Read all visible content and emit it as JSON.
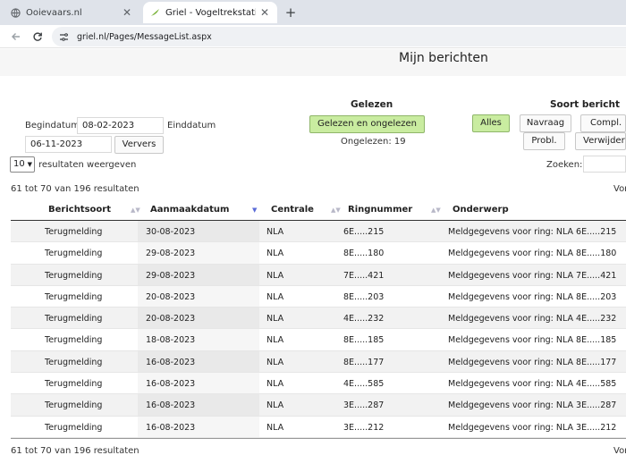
{
  "browser": {
    "tabs": [
      {
        "title": "Ooievaars.nl",
        "active": false
      },
      {
        "title": "Griel - Vogeltrekstation Neder",
        "active": true
      }
    ],
    "new_tab_label": "+",
    "url": "griel.nl/Pages/MessageList.aspx"
  },
  "page": {
    "title": "Mijn berichten"
  },
  "filters": {
    "begindatum_label": "Begindatum",
    "begindatum_value": "08-02-2023",
    "einddatum_label": "Einddatum",
    "einddatum_value": "06-11-2023",
    "ververs_label": "Ververs",
    "gelezen_heading": "Gelezen",
    "gelezen_button": "Gelezen en ongelezen",
    "ongelezen_text": "Ongelezen: 19",
    "soort_heading": "Soort bericht",
    "soort_buttons": [
      "Alles",
      "Navraag",
      "Compl.",
      "Probl.",
      "Verwijderd"
    ]
  },
  "table_controls": {
    "page_size": "10",
    "page_size_suffix": "resultaten weergeven",
    "search_label": "Zoeken:",
    "info_top": "61 tot 70 van 196 resultaten",
    "info_bottom": "61 tot 70 van 196 resultaten",
    "pager_cut": "Vor"
  },
  "table": {
    "headers": [
      "Berichtsoort",
      "Aanmaakdatum",
      "Centrale",
      "Ringnummer",
      "Onderwerp"
    ],
    "sorted_column": "Aanmaakdatum",
    "sort_direction": "desc",
    "rows": [
      [
        "Terugmelding",
        "30-08-2023",
        "NLA",
        "6E.....215",
        "Meldgegevens voor ring: NLA 6E.....215"
      ],
      [
        "Terugmelding",
        "29-08-2023",
        "NLA",
        "8E.....180",
        "Meldgegevens voor ring: NLA 8E.....180"
      ],
      [
        "Terugmelding",
        "29-08-2023",
        "NLA",
        "7E.....421",
        "Meldgegevens voor ring: NLA 7E.....421"
      ],
      [
        "Terugmelding",
        "20-08-2023",
        "NLA",
        "8E.....203",
        "Meldgegevens voor ring: NLA 8E.....203"
      ],
      [
        "Terugmelding",
        "20-08-2023",
        "NLA",
        "4E.....232",
        "Meldgegevens voor ring: NLA 4E.....232"
      ],
      [
        "Terugmelding",
        "18-08-2023",
        "NLA",
        "8E.....185",
        "Meldgegevens voor ring: NLA 8E.....185"
      ],
      [
        "Terugmelding",
        "16-08-2023",
        "NLA",
        "8E.....177",
        "Meldgegevens voor ring: NLA 8E.....177"
      ],
      [
        "Terugmelding",
        "16-08-2023",
        "NLA",
        "4E.....585",
        "Meldgegevens voor ring: NLA 4E.....585"
      ],
      [
        "Terugmelding",
        "16-08-2023",
        "NLA",
        "3E.....287",
        "Meldgegevens voor ring: NLA 3E.....287"
      ],
      [
        "Terugmelding",
        "16-08-2023",
        "NLA",
        "3E.....212",
        "Meldgegevens voor ring: NLA 3E.....212"
      ]
    ]
  },
  "colors": {
    "green_button": "#c9eca0",
    "tabbar": "#dfe3ea",
    "sort_active": "#5a6bd8"
  }
}
